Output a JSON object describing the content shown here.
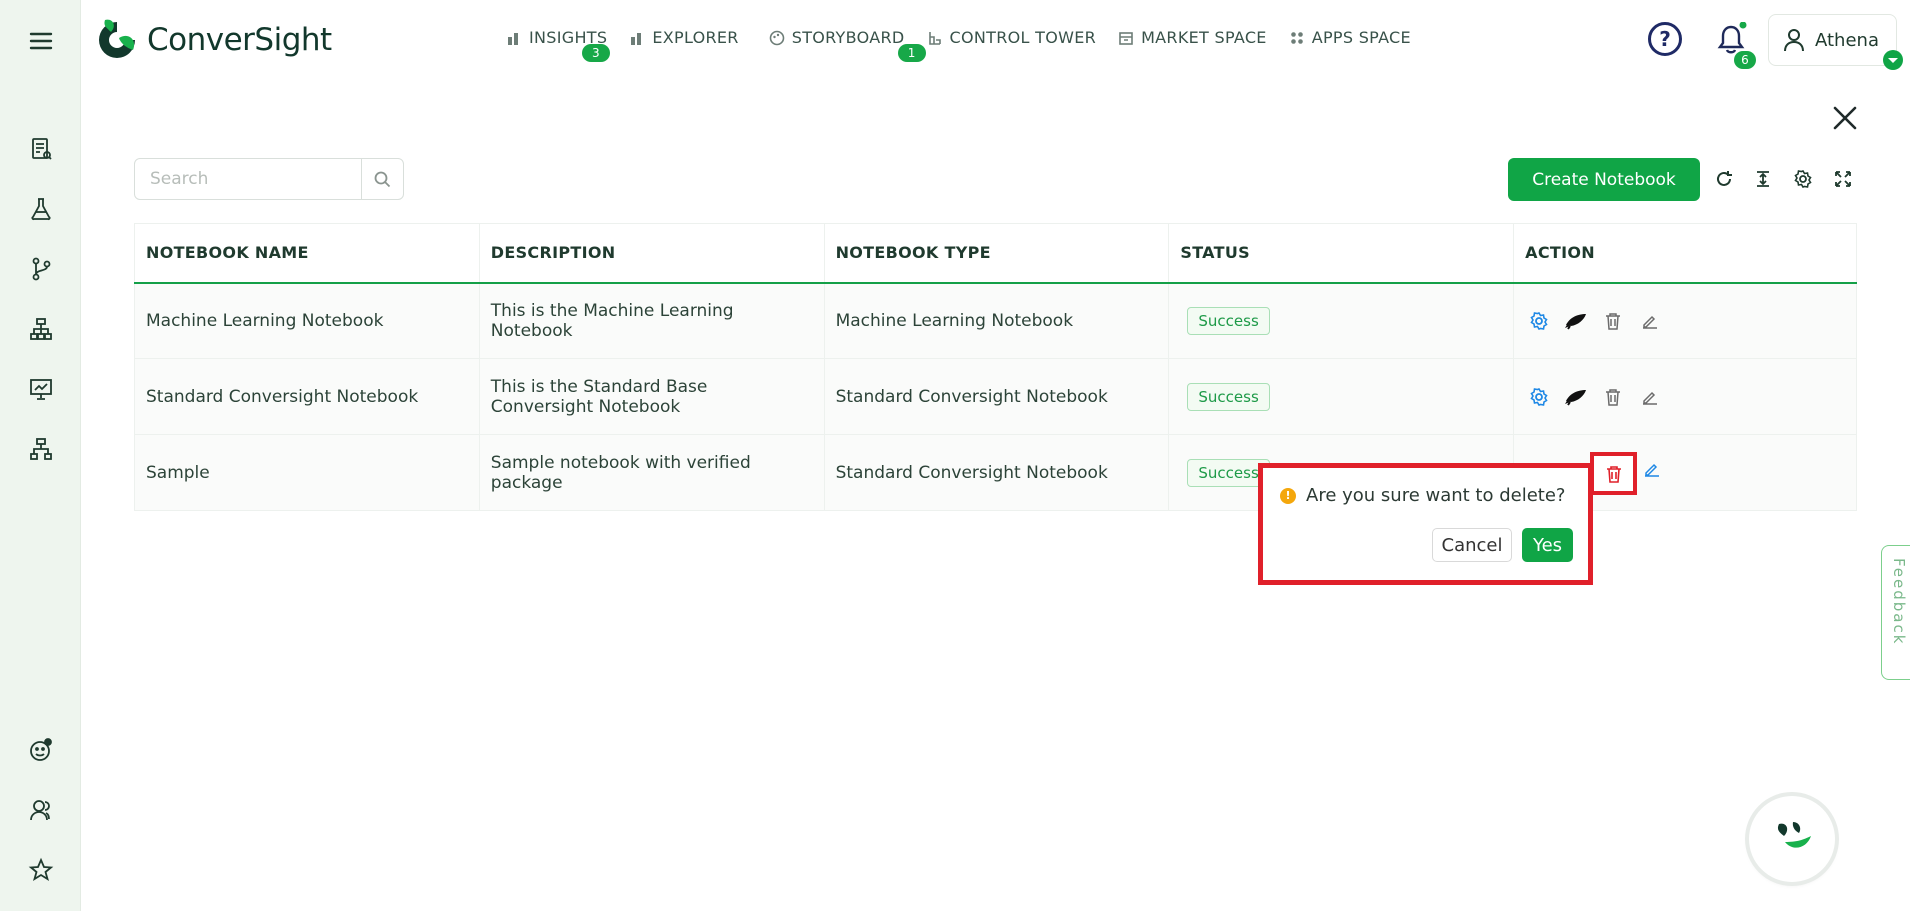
{
  "brand": {
    "name": "ConverSight",
    "green": "#10a546",
    "dark": "#12382c"
  },
  "nav": [
    {
      "label": "INSIGHTS",
      "icon": "bar-chart-icon",
      "badge": "3"
    },
    {
      "label": "EXPLORER",
      "icon": "bar-chart-icon",
      "badge": ""
    },
    {
      "label": "STORYBOARD",
      "icon": "palette-icon",
      "badge": "1"
    },
    {
      "label": "CONTROL TOWER",
      "icon": "tower-icon",
      "badge": ""
    },
    {
      "label": "MARKET SPACE",
      "icon": "store-icon",
      "badge": ""
    },
    {
      "label": "APPS SPACE",
      "icon": "grid-icon",
      "badge": ""
    }
  ],
  "header": {
    "notifications_count": "6",
    "user_name": "Athena"
  },
  "toolbar": {
    "search_placeholder": "Search",
    "create_label": "Create Notebook"
  },
  "table": {
    "columns": [
      "NOTEBOOK NAME",
      "DESCRIPTION",
      "NOTEBOOK TYPE",
      "STATUS",
      "ACTION"
    ],
    "rows": [
      {
        "name": "Machine Learning Notebook",
        "description": "This is the Machine Learning Notebook",
        "type": "Machine Learning Notebook",
        "status": "Success"
      },
      {
        "name": "Standard Conversight Notebook",
        "description": "This is the Standard Base Conversight Notebook",
        "type": "Standard Conversight Notebook",
        "status": "Success"
      },
      {
        "name": "Sample",
        "description": "Sample notebook with verified package",
        "type": "Standard Conversight Notebook",
        "status": "Success"
      }
    ]
  },
  "confirm": {
    "message": "Are you sure want to delete?",
    "cancel_label": "Cancel",
    "yes_label": "Yes"
  },
  "feedback_label": "Feedback"
}
